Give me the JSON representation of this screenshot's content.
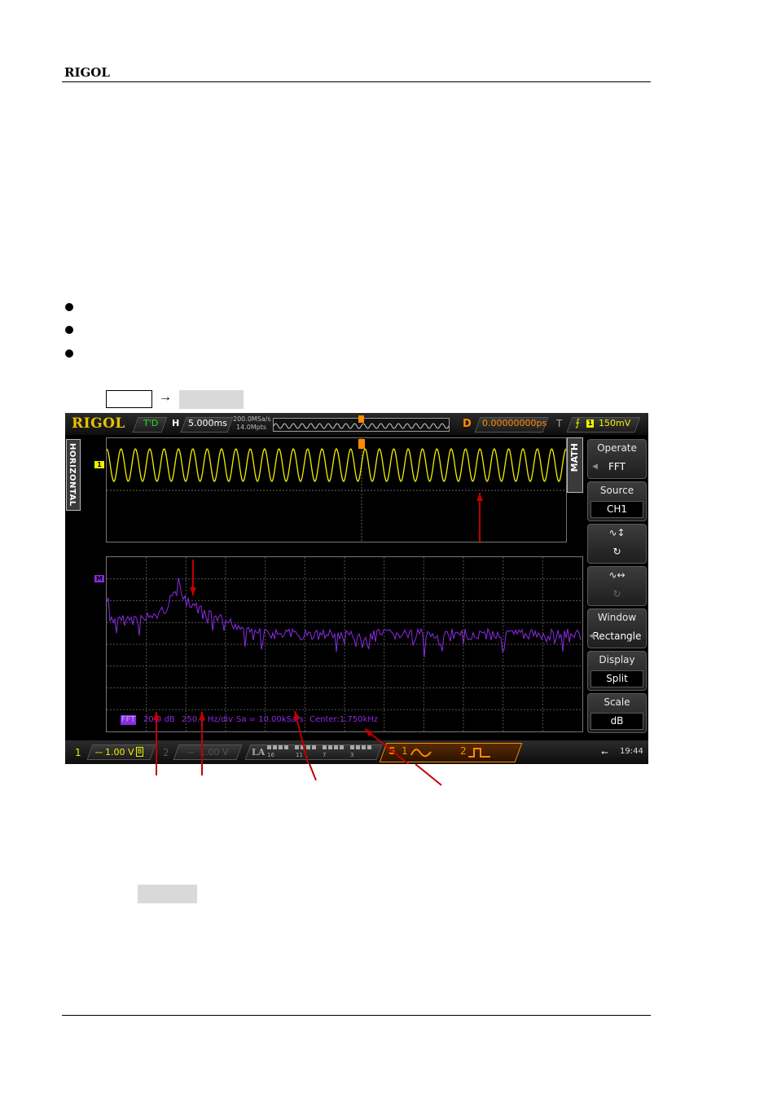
{
  "header": {
    "brand": "RIGOL"
  },
  "instructions": {
    "bullets": [
      "",
      "",
      ""
    ],
    "key_path": {
      "key": "",
      "arrow": "→",
      "softkey": ""
    }
  },
  "scope": {
    "logo": "RIGOL",
    "status": {
      "run_state": "T'D",
      "horizontal_label": "H",
      "timebase": "5.000ms",
      "sample_rate": "200.0MSa/s",
      "memory_depth": "14.0Mpts",
      "delay_label": "D",
      "delay_value": "0.00000000ps",
      "trigger_label": "T",
      "trigger_source": "1",
      "trigger_level": "150mV"
    },
    "side_tab_left": "HORIZONTAL",
    "side_tab_right": "MATH",
    "menu": [
      {
        "title": "Operate",
        "value": "FFT",
        "arrow": "◀"
      },
      {
        "title": "Source",
        "value": "CH1"
      },
      {
        "title": "∿↕",
        "value": "↻",
        "icon": "vertical-offset-icon"
      },
      {
        "title": "∿↔",
        "value": "↻",
        "icon": "vertical-scale-icon"
      },
      {
        "title": "Window",
        "value": "Rectangle",
        "arrow": "◀"
      },
      {
        "title": "Display",
        "value": "Split"
      },
      {
        "title": "Scale",
        "value": "dB"
      }
    ],
    "channel_marker": "1",
    "math_marker": "M",
    "fft_info": {
      "tag": "FFT",
      "scale": "20.0 dB",
      "hz_div": "250.0 Hz/div",
      "sample": "Sa = 10.00kSa/s",
      "center": "Center:1.750kHz"
    },
    "bottom": {
      "ch1_num": "1",
      "ch1_coupling": "⎓",
      "ch1_scale": "1.00 V",
      "ch1_bw": "B",
      "ch2_num": "2",
      "ch2_coupling": "⎓",
      "ch2_scale": "1.00 V",
      "la_label": "LA",
      "la_numbers": [
        "16",
        "11",
        "7",
        "3"
      ],
      "s_label": "S",
      "src1": "1",
      "src2": "2",
      "time": "19:44"
    },
    "colors": {
      "ch1": "#f0f000",
      "math": "#8a2be2",
      "accent": "#ff8c00",
      "annotation": "#c00000"
    }
  }
}
